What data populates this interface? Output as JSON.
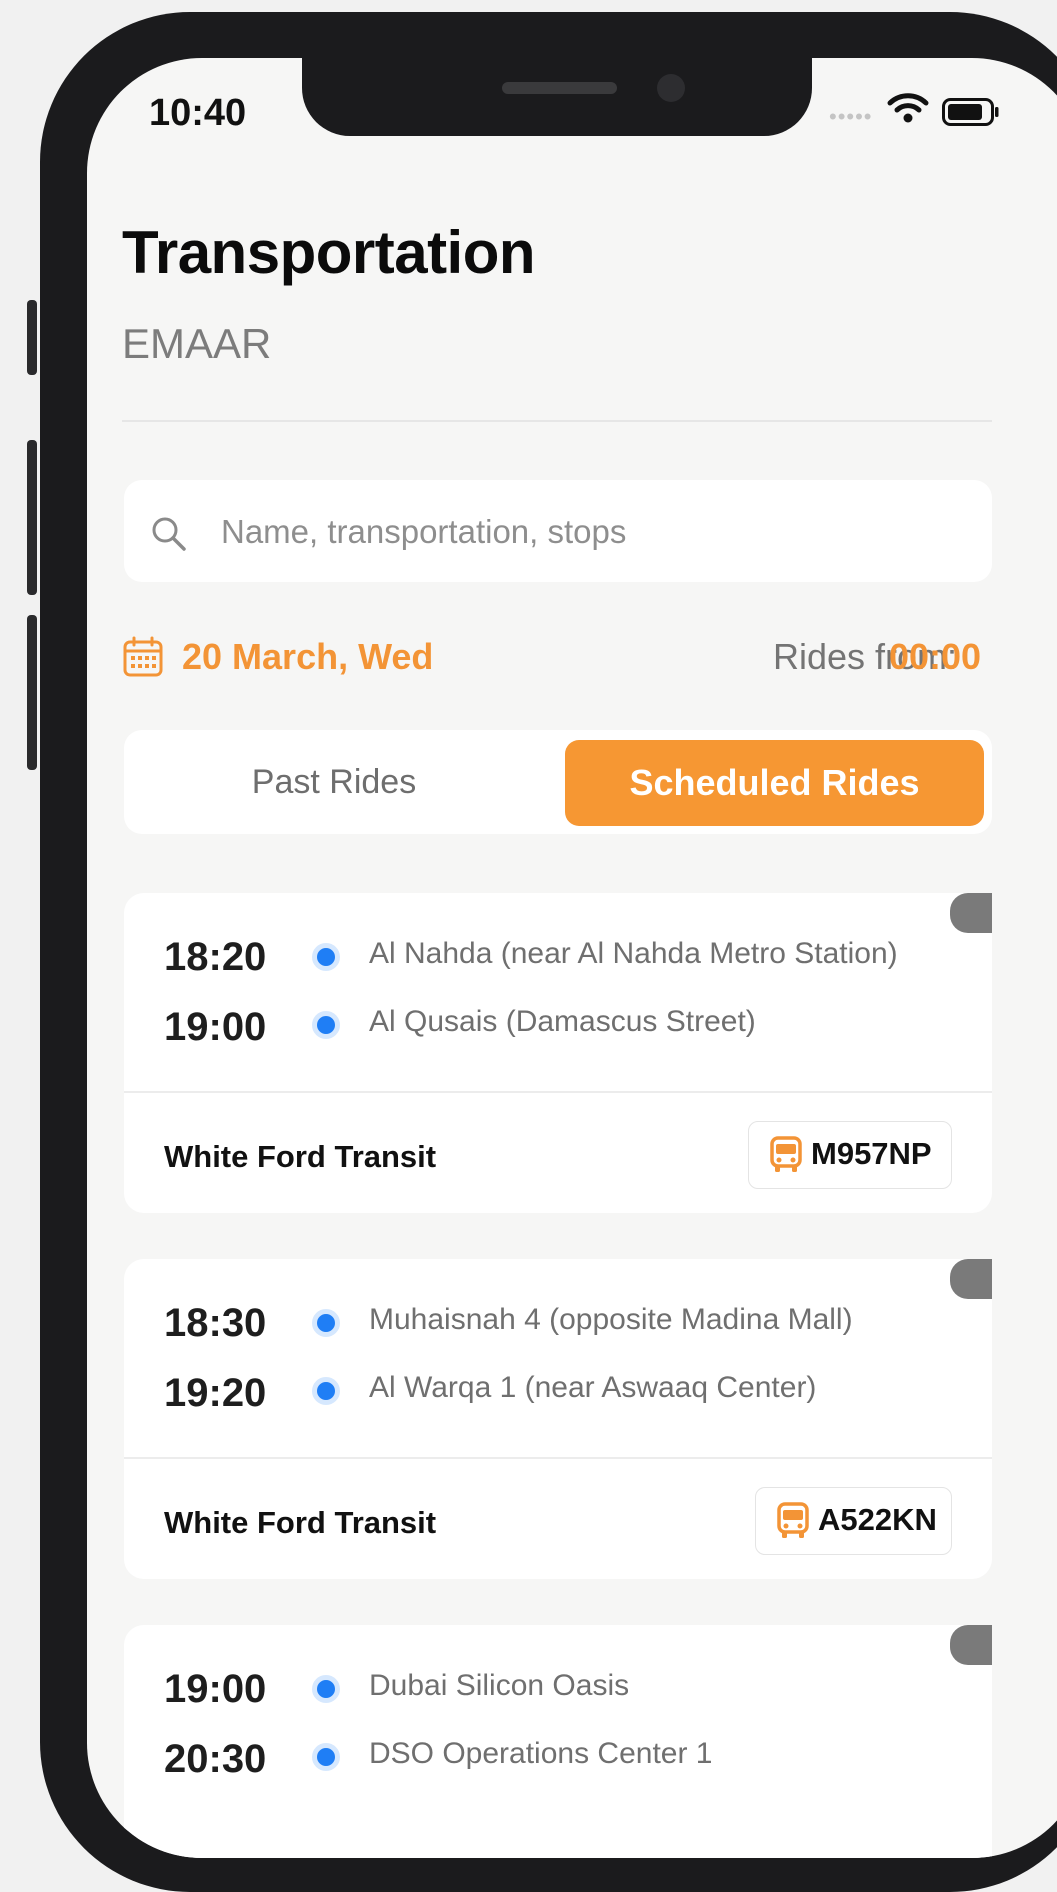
{
  "status_bar": {
    "time": "10:40"
  },
  "header": {
    "title": "Transportation",
    "subtitle": "EMAAR"
  },
  "search": {
    "placeholder": "Name, transportation, stops"
  },
  "filters": {
    "date": "20 March, Wed",
    "rides_from_label": "Rides from:",
    "rides_from_time": "00:00"
  },
  "tabs": {
    "past": "Past Rides",
    "scheduled": "Scheduled Rides",
    "active": "scheduled"
  },
  "accent_color": "#f69733",
  "stop_dot_color": "#1f7ef5",
  "rides": [
    {
      "depart_time": "18:20",
      "from": "Al Nahda (near Al Nahda Metro Station)",
      "arrive_time": "19:00",
      "to": "Al Qusais (Damascus Street)",
      "vehicle": "White Ford Transit",
      "plate": "M957NP",
      "plate_icon": "bus-icon"
    },
    {
      "depart_time": "18:30",
      "from": "Muhaisnah 4 (opposite Madina Mall)",
      "arrive_time": "19:20",
      "to": "Al Warqa 1 (near Aswaaq Center)",
      "vehicle": "White Ford Transit",
      "plate": "A522KN",
      "plate_icon": "bus-icon"
    },
    {
      "depart_time": "19:00",
      "from": "Dubai Silicon Oasis",
      "arrive_time": "20:30",
      "to": "DSO Operations Center 1"
    }
  ]
}
